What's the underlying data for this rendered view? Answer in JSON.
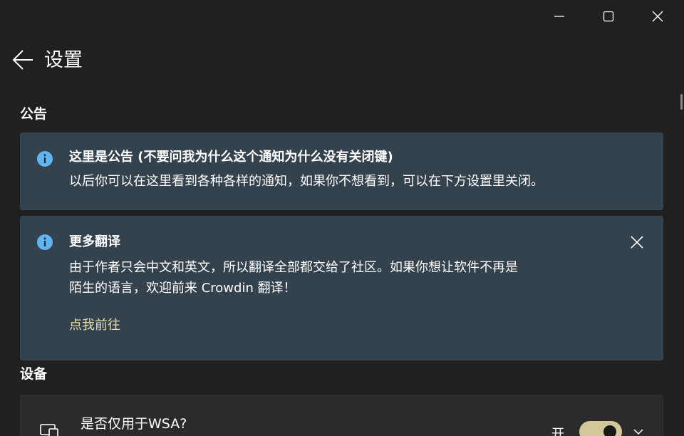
{
  "window": {
    "minimize_icon": "minimize-icon",
    "maximize_icon": "maximize-icon",
    "close_icon": "close-icon"
  },
  "header": {
    "back_icon": "back-arrow-icon",
    "title": "设置"
  },
  "sections": {
    "announcement": "公告",
    "device": "设备"
  },
  "announcements": [
    {
      "icon": "info-icon",
      "title": "这里是公告 (不要问我为什么这个通知为什么没有关闭键)",
      "message": "以后你可以在这里看到各种各样的通知，如果你不想看到，可以在下方设置里关闭。"
    },
    {
      "icon": "info-icon",
      "title": "更多翻译",
      "message_line1": "由于作者只会中文和英文，所以翻译全部都交给了社区。如果你想让软件不再是",
      "message_line2": "陌生的语言，欢迎前来 Crowdin 翻译！",
      "link": "点我前往",
      "link_color": "#e4dcae"
    }
  ],
  "device_card": {
    "icon": "devices-icon",
    "label": "是否仅用于WSA?",
    "toggle_state": "开",
    "toggle_on": true,
    "expand_icon": "chevron-down-icon"
  },
  "colors": {
    "background": "#202020",
    "infobar": "#34424e",
    "info_icon": "#60b4f0",
    "accent": "#d4c89a"
  }
}
